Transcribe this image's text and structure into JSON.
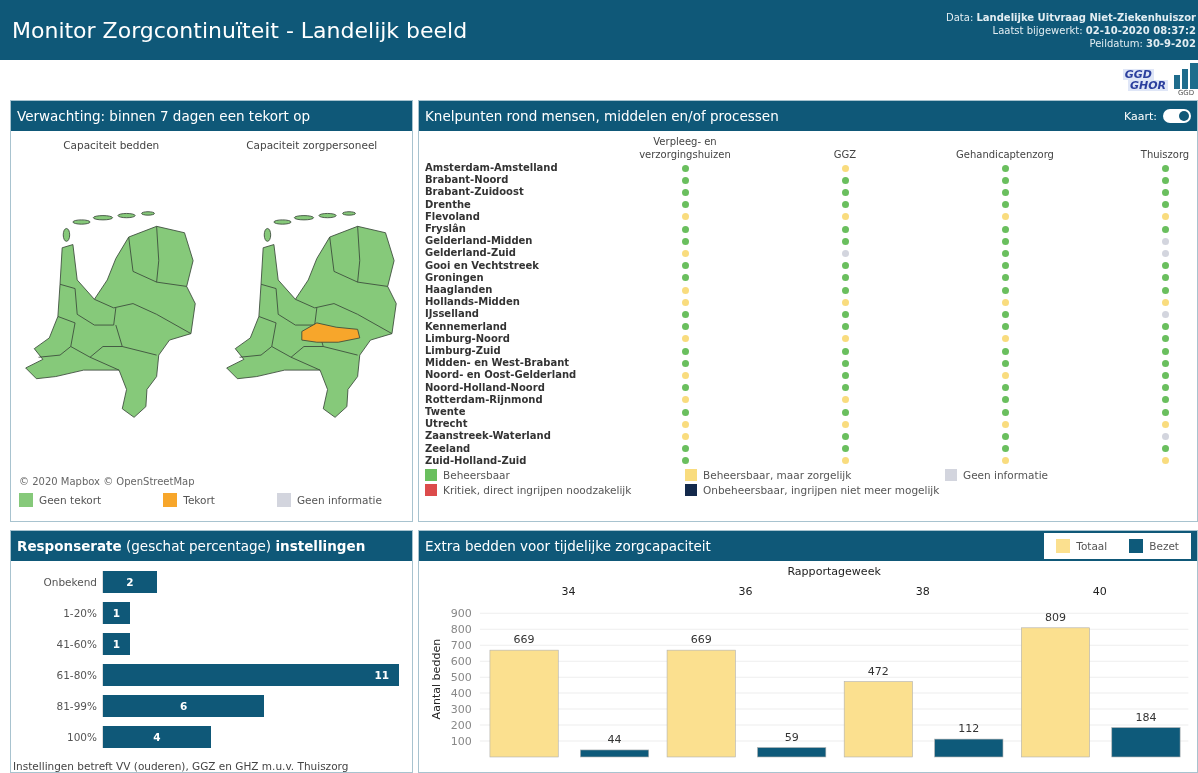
{
  "header": {
    "title": "Monitor Zorgcontinuïteit - Landelijk beeld",
    "info": [
      "Data: **Landelijke Uitvraag Niet-Ziekenhuiszor**",
      "Laatst bijgewerkt: **02-10-2020 08:37:2**",
      "Peildatum: **30-9-202**"
    ],
    "logos": [
      {
        "kind": "ggdghor",
        "lines": [
          "GGD",
          "GHOR"
        ]
      },
      {
        "kind": "ggdbars",
        "lines": [
          "GGD"
        ]
      }
    ]
  },
  "shortage_panel": {
    "title": "Verwachting: binnen 7 dagen een tekort op",
    "maps": [
      {
        "title": "Capaciteit bedden",
        "shortage": false
      },
      {
        "title": "Capaciteit zorgpersoneel",
        "shortage": true
      }
    ],
    "attribution": "© 2020 Mapbox © OpenStreetMap",
    "legend": [
      {
        "label": "Geen tekort",
        "color": "#86c97a"
      },
      {
        "label": "Tekort",
        "color": "#f7a62b"
      },
      {
        "label": "Geen informatie",
        "color": "#d3d5de"
      }
    ]
  },
  "bottleneck_panel": {
    "title": "Knelpunten rond mensen, middelen en/of processen",
    "toggle": {
      "label": "Kaart:",
      "on": true
    },
    "columns": [
      "Verpleeg- en verzorgingshuizen",
      "GGZ",
      "Gehandicaptenzorg",
      "Thuiszorg"
    ],
    "rows": [
      {
        "name": "Amsterdam-Amstelland",
        "cells": [
          {
            "color": "#6abf5e"
          },
          {
            "color": "#f9dc7e"
          },
          {
            "color": "#6abf5e"
          },
          {
            "color": "#6abf5e"
          }
        ]
      },
      {
        "name": "Brabant-Noord",
        "cells": [
          {
            "color": "#6abf5e"
          },
          {
            "color": "#6abf5e"
          },
          {
            "color": "#6abf5e"
          },
          {
            "color": "#6abf5e"
          }
        ]
      },
      {
        "name": "Brabant-Zuidoost",
        "cells": [
          {
            "color": "#6abf5e"
          },
          {
            "color": "#6abf5e"
          },
          {
            "color": "#6abf5e"
          },
          {
            "color": "#6abf5e"
          }
        ]
      },
      {
        "name": "Drenthe",
        "cells": [
          {
            "color": "#6abf5e"
          },
          {
            "color": "#6abf5e"
          },
          {
            "color": "#6abf5e"
          },
          {
            "color": "#6abf5e"
          }
        ]
      },
      {
        "name": "Flevoland",
        "cells": [
          {
            "color": "#f9dc7e"
          },
          {
            "color": "#f9dc7e"
          },
          {
            "color": "#f9dc7e"
          },
          {
            "color": "#f9dc7e"
          }
        ]
      },
      {
        "name": "Fryslân",
        "cells": [
          {
            "color": "#6abf5e"
          },
          {
            "color": "#6abf5e"
          },
          {
            "color": "#6abf5e"
          },
          {
            "color": "#6abf5e"
          }
        ]
      },
      {
        "name": "Gelderland-Midden",
        "cells": [
          {
            "color": "#6abf5e"
          },
          {
            "color": "#6abf5e"
          },
          {
            "color": "#6abf5e"
          },
          {
            "color": "#d3d5de"
          }
        ]
      },
      {
        "name": "Gelderland-Zuid",
        "cells": [
          {
            "color": "#f9dc7e"
          },
          {
            "color": "#d3d5de"
          },
          {
            "color": "#6abf5e"
          },
          {
            "color": "#d3d5de"
          }
        ]
      },
      {
        "name": "Gooi en Vechtstreek",
        "cells": [
          {
            "color": "#6abf5e"
          },
          {
            "color": "#6abf5e"
          },
          {
            "color": "#6abf5e"
          },
          {
            "color": "#6abf5e"
          }
        ]
      },
      {
        "name": "Groningen",
        "cells": [
          {
            "color": "#6abf5e"
          },
          {
            "color": "#6abf5e"
          },
          {
            "color": "#6abf5e"
          },
          {
            "color": "#6abf5e"
          }
        ]
      },
      {
        "name": "Haaglanden",
        "cells": [
          {
            "color": "#f9dc7e"
          },
          {
            "color": "#6abf5e"
          },
          {
            "color": "#6abf5e"
          },
          {
            "color": "#6abf5e"
          }
        ]
      },
      {
        "name": "Hollands-Midden",
        "cells": [
          {
            "color": "#f9dc7e"
          },
          {
            "color": "#f9dc7e"
          },
          {
            "color": "#f9dc7e"
          },
          {
            "color": "#f9dc7e"
          }
        ]
      },
      {
        "name": "IJsselland",
        "cells": [
          {
            "color": "#6abf5e"
          },
          {
            "color": "#6abf5e"
          },
          {
            "color": "#6abf5e"
          },
          {
            "color": "#d3d5de"
          }
        ]
      },
      {
        "name": "Kennemerland",
        "cells": [
          {
            "color": "#6abf5e"
          },
          {
            "color": "#6abf5e"
          },
          {
            "color": "#6abf5e"
          },
          {
            "color": "#6abf5e"
          }
        ]
      },
      {
        "name": "Limburg-Noord",
        "cells": [
          {
            "color": "#f9dc7e"
          },
          {
            "color": "#f9dc7e"
          },
          {
            "color": "#f9dc7e"
          },
          {
            "color": "#6abf5e"
          }
        ]
      },
      {
        "name": "Limburg-Zuid",
        "cells": [
          {
            "color": "#6abf5e"
          },
          {
            "color": "#6abf5e"
          },
          {
            "color": "#6abf5e"
          },
          {
            "color": "#6abf5e"
          }
        ]
      },
      {
        "name": "Midden- en West-Brabant",
        "cells": [
          {
            "color": "#6abf5e"
          },
          {
            "color": "#6abf5e"
          },
          {
            "color": "#6abf5e"
          },
          {
            "color": "#6abf5e"
          }
        ]
      },
      {
        "name": "Noord- en Oost-Gelderland",
        "cells": [
          {
            "color": "#f9dc7e"
          },
          {
            "color": "#6abf5e"
          },
          {
            "color": "#f9dc7e"
          },
          {
            "color": "#6abf5e"
          }
        ]
      },
      {
        "name": "Noord-Holland-Noord",
        "cells": [
          {
            "color": "#6abf5e"
          },
          {
            "color": "#6abf5e"
          },
          {
            "color": "#6abf5e"
          },
          {
            "color": "#6abf5e"
          }
        ]
      },
      {
        "name": "Rotterdam-Rijnmond",
        "cells": [
          {
            "color": "#f9dc7e"
          },
          {
            "color": "#f9dc7e"
          },
          {
            "color": "#6abf5e"
          },
          {
            "color": "#6abf5e"
          }
        ]
      },
      {
        "name": "Twente",
        "cells": [
          {
            "color": "#6abf5e"
          },
          {
            "color": "#6abf5e"
          },
          {
            "color": "#6abf5e"
          },
          {
            "color": "#6abf5e"
          }
        ]
      },
      {
        "name": "Utrecht",
        "cells": [
          {
            "color": "#f9dc7e"
          },
          {
            "color": "#f9dc7e"
          },
          {
            "color": "#f9dc7e"
          },
          {
            "color": "#f9dc7e"
          }
        ]
      },
      {
        "name": "Zaanstreek-Waterland",
        "cells": [
          {
            "color": "#f9dc7e"
          },
          {
            "color": "#6abf5e"
          },
          {
            "color": "#6abf5e"
          },
          {
            "color": "#d3d5de"
          }
        ]
      },
      {
        "name": "Zeeland",
        "cells": [
          {
            "color": "#6abf5e"
          },
          {
            "color": "#6abf5e"
          },
          {
            "color": "#6abf5e"
          },
          {
            "color": "#6abf5e"
          }
        ]
      },
      {
        "name": "Zuid-Holland-Zuid",
        "cells": [
          {
            "color": "#6abf5e"
          },
          {
            "color": "#f9dc7e"
          },
          {
            "color": "#f9dc7e"
          },
          {
            "color": "#f9dc7e"
          }
        ]
      }
    ],
    "legend": [
      {
        "label": "Beheersbaar",
        "color": "#6abf5e"
      },
      {
        "label": "Beheersbaar, maar zorgelijk",
        "color": "#f9dc7e"
      },
      {
        "label": "Geen informatie",
        "color": "#d3d5de"
      },
      {
        "label": "Kritiek, direct ingrijpen noodzakelijk",
        "color": "#dc4b4b"
      },
      {
        "label": "Onbeheersbaar, ingrijpen niet meer mogelijk",
        "color": "#13294b"
      }
    ]
  },
  "response_panel": {
    "title": "**Responserate** (geschat percentage) **instellingen**",
    "footnote": "Instellingen betreft VV (ouderen), GGZ en GHZ m.u.v. Thuiszorg",
    "chart_data": {
      "type": "bar",
      "orientation": "horizontal",
      "categories": [
        "Onbekend",
        "1-20%",
        "41-60%",
        "61-80%",
        "81-99%",
        "100%"
      ],
      "values": [
        2,
        1,
        1,
        11,
        6,
        4
      ],
      "data_labels": true
    }
  },
  "beds_panel": {
    "title": "Extra bedden voor tijdelijke zorgcapaciteit",
    "chart_data": {
      "type": "bar",
      "xlabel": "Rapportageweek",
      "ylabel": "Aantal bedden",
      "categories": [
        "34",
        "36",
        "38",
        "40"
      ],
      "series": [
        {
          "name": "Totaal",
          "color": "#fbe08f",
          "values": [
            669,
            669,
            472,
            809
          ]
        },
        {
          "name": "Bezet",
          "color": "#0e5a7a",
          "values": [
            44,
            59,
            112,
            184
          ]
        }
      ],
      "ylim": [
        0,
        900
      ],
      "grid": true,
      "yticks": [
        100,
        200,
        300,
        400,
        500,
        600,
        700,
        800,
        900
      ],
      "data_labels": true
    }
  }
}
